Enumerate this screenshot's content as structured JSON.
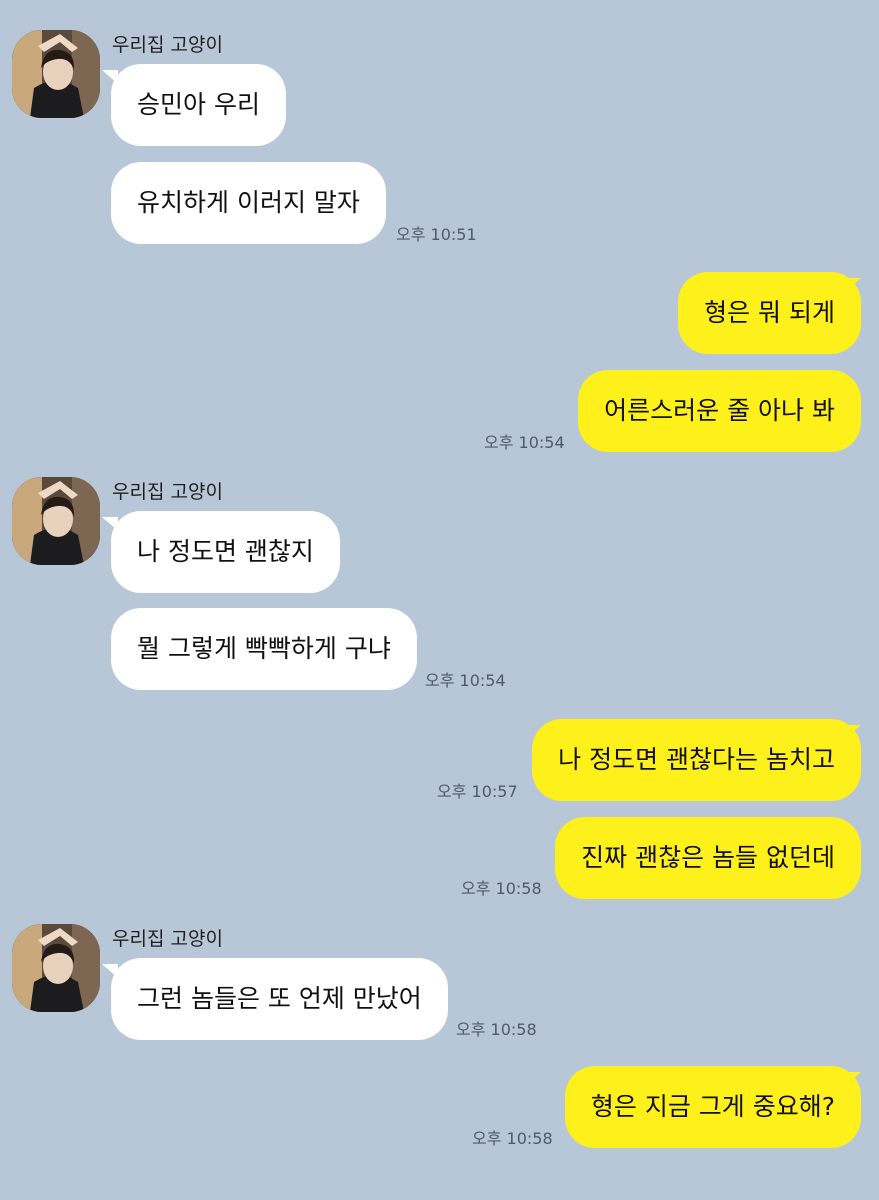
{
  "chat": {
    "background": "#b8c7d7",
    "incoming_bubble_color": "#ffffff",
    "outgoing_bubble_color": "#fef01b",
    "groups": [
      {
        "sender": "우리집 고양이",
        "avatar_icon": "profile-photo-avatar",
        "messages": [
          "승민아 우리",
          "유치하게 이러지 말자"
        ],
        "time": "오후 10:51"
      },
      {
        "sender": "me",
        "messages": [
          "형은 뭐 되게",
          "어른스러운 줄 아나 봐"
        ],
        "time": "오후 10:54"
      },
      {
        "sender": "우리집 고양이",
        "avatar_icon": "profile-photo-avatar",
        "messages": [
          "나 정도면 괜찮지",
          "뭘 그렇게 빡빡하게 구냐"
        ],
        "time": "오후 10:54"
      },
      {
        "sender": "me",
        "messages": [
          "나 정도면 괜찮다는 놈치고"
        ],
        "time": "오후 10:57"
      },
      {
        "sender": "me",
        "messages": [
          "진짜 괜찮은 놈들 없던데"
        ],
        "time": "오후 10:58"
      },
      {
        "sender": "우리집 고양이",
        "avatar_icon": "profile-photo-avatar",
        "messages": [
          "그런 놈들은 또 언제 만났어"
        ],
        "time": "오후 10:58"
      },
      {
        "sender": "me",
        "messages": [
          "형은 지금 그게 중요해?"
        ],
        "time": "오후 10:58"
      }
    ]
  }
}
